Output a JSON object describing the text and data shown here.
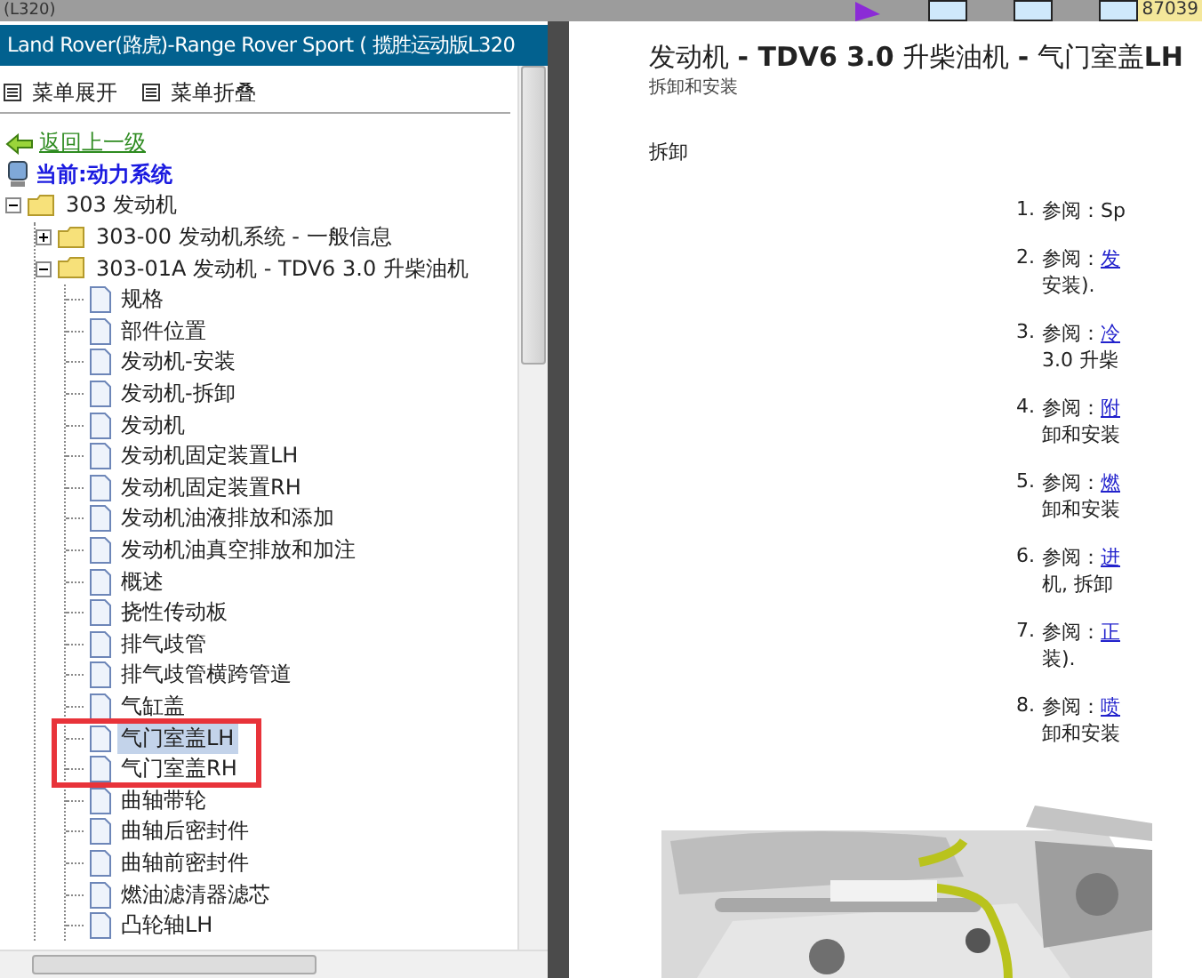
{
  "top_bar": {
    "caption": "(L320)",
    "counter": "87039"
  },
  "sidebar": {
    "title": "Land Rover(路虎)-Range Rover Sport ( 揽胜运动版L320",
    "menu_buttons": [
      "菜单展开",
      "菜单折叠"
    ],
    "back_link": "返回上一级",
    "current_section": "当前:动力系统",
    "tree": [
      {
        "label": "303 发动机",
        "expanded": true,
        "children": [
          {
            "label": "303-00 发动机系统 - 一般信息",
            "expanded": false
          },
          {
            "label": "303-01A 发动机 - TDV6 3.0 升柴油机",
            "expanded": true,
            "children": [
              {
                "label": "规格",
                "selected": false,
                "circled": false
              },
              {
                "label": "部件位置",
                "selected": false,
                "circled": false
              },
              {
                "label": "发动机-安装",
                "selected": false,
                "circled": false
              },
              {
                "label": "发动机-拆卸",
                "selected": false,
                "circled": false
              },
              {
                "label": "发动机",
                "selected": false,
                "circled": false
              },
              {
                "label": "发动机固定装置LH",
                "selected": false,
                "circled": false
              },
              {
                "label": "发动机固定装置RH",
                "selected": false,
                "circled": false
              },
              {
                "label": "发动机油液排放和添加",
                "selected": false,
                "circled": false
              },
              {
                "label": "发动机油真空排放和加注",
                "selected": false,
                "circled": false
              },
              {
                "label": "概述",
                "selected": false,
                "circled": false
              },
              {
                "label": "挠性传动板",
                "selected": false,
                "circled": false
              },
              {
                "label": "排气歧管",
                "selected": false,
                "circled": false
              },
              {
                "label": "排气歧管横跨管道",
                "selected": false,
                "circled": false
              },
              {
                "label": "气缸盖",
                "selected": false,
                "circled": false
              },
              {
                "label": "气门室盖LH",
                "selected": true,
                "circled": true
              },
              {
                "label": "气门室盖RH",
                "selected": false,
                "circled": true
              },
              {
                "label": "曲轴带轮",
                "selected": false,
                "circled": false
              },
              {
                "label": "曲轴后密封件",
                "selected": false,
                "circled": false
              },
              {
                "label": "曲轴前密封件",
                "selected": false,
                "circled": false
              },
              {
                "label": "燃油滤清器滤芯",
                "selected": false,
                "circled": false
              },
              {
                "label": "凸轮轴LH",
                "selected": false,
                "circled": false
              }
            ]
          }
        ]
      }
    ]
  },
  "document": {
    "title": "发动机 **- TDV6 3.0** 升柴油机 **-** 气门室盖**LH**",
    "subtitle": "拆卸和安装",
    "section": "拆卸",
    "steps": [
      {
        "number": "1.",
        "prefix": "参阅：Sp"
      },
      {
        "number": "2.",
        "prefix": "参阅：",
        "link": "发",
        "continuation": "安装)."
      },
      {
        "number": "3.",
        "prefix": "参阅：",
        "link": "冷",
        "continuation": "3.0 升柴"
      },
      {
        "number": "4.",
        "prefix": "参阅：",
        "link": "附",
        "continuation": "卸和安装"
      },
      {
        "number": "5.",
        "prefix": "参阅：",
        "link": "燃",
        "continuation": "卸和安装"
      },
      {
        "number": "6.",
        "prefix": "参阅：",
        "link": "进",
        "continuation": "机, 拆卸"
      },
      {
        "number": "7.",
        "prefix": "参阅：",
        "link": "正",
        "continuation": "装)."
      },
      {
        "number": "8.",
        "prefix": "参阅：",
        "link": "喷",
        "continuation": "卸和安装"
      }
    ]
  }
}
